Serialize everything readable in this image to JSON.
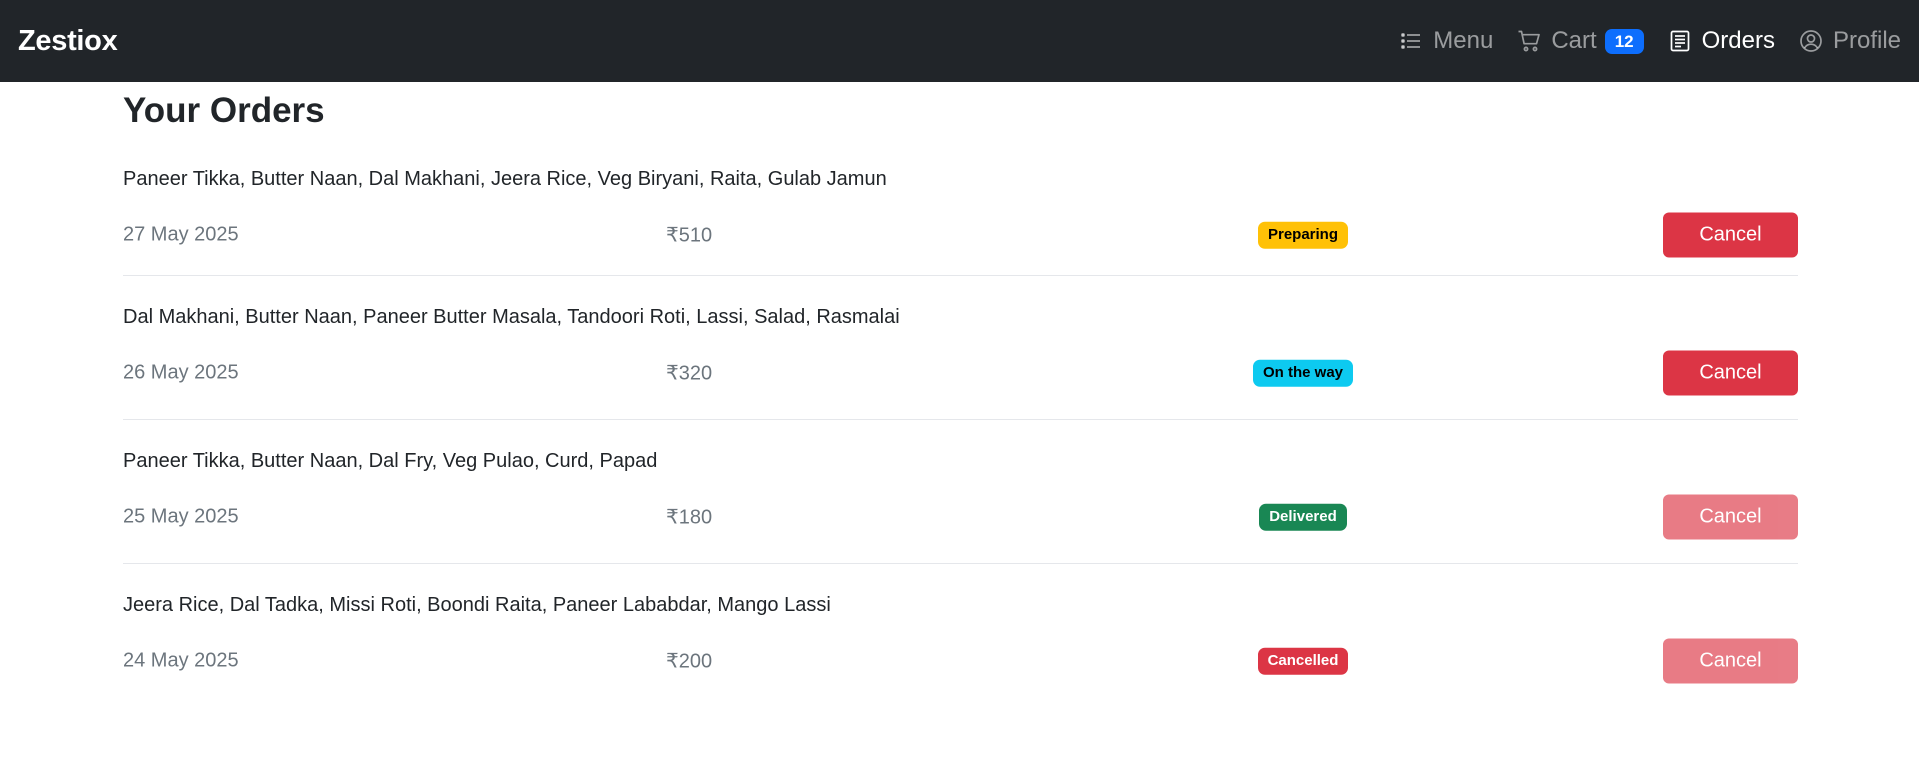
{
  "app": {
    "brand": "Zestiox"
  },
  "nav": {
    "menu_label": "Menu",
    "cart_label": "Cart",
    "cart_count": "12",
    "orders_label": "Orders",
    "profile_label": "Profile"
  },
  "page": {
    "title": "Your Orders"
  },
  "colors": {
    "navbar": "#212529",
    "primary": "#0d6efd",
    "danger": "#dc3545",
    "warning": "#ffc107",
    "info": "#0dcaf0",
    "success": "#198754"
  },
  "orders": [
    {
      "items": "Paneer Tikka, Butter Naan, Dal Makhani, Jeera Rice, Veg Biryani, Raita, Gulab Jamun",
      "date": "27 May 2025",
      "price": "₹510",
      "status": "Preparing",
      "status_color": "#ffc107",
      "status_text_color": "#000000",
      "cancel_label": "Cancel",
      "cancel_enabled": true
    },
    {
      "items": "Dal Makhani, Butter Naan, Paneer Butter Masala, Tandoori Roti, Lassi, Salad, Rasmalai",
      "date": "26 May 2025",
      "price": "₹320",
      "status": "On the way",
      "status_color": "#0dcaf0",
      "status_text_color": "#000000",
      "cancel_label": "Cancel",
      "cancel_enabled": true
    },
    {
      "items": "Paneer Tikka, Butter Naan, Dal Fry, Veg Pulao, Curd, Papad",
      "date": "25 May 2025",
      "price": "₹180",
      "status": "Delivered",
      "status_color": "#198754",
      "status_text_color": "#ffffff",
      "cancel_label": "Cancel",
      "cancel_enabled": false
    },
    {
      "items": "Jeera Rice, Dal Tadka, Missi Roti, Boondi Raita, Paneer Lababdar, Mango Lassi",
      "date": "24 May 2025",
      "price": "₹200",
      "status": "Cancelled",
      "status_color": "#dc3545",
      "status_text_color": "#ffffff",
      "cancel_label": "Cancel",
      "cancel_enabled": false
    }
  ]
}
